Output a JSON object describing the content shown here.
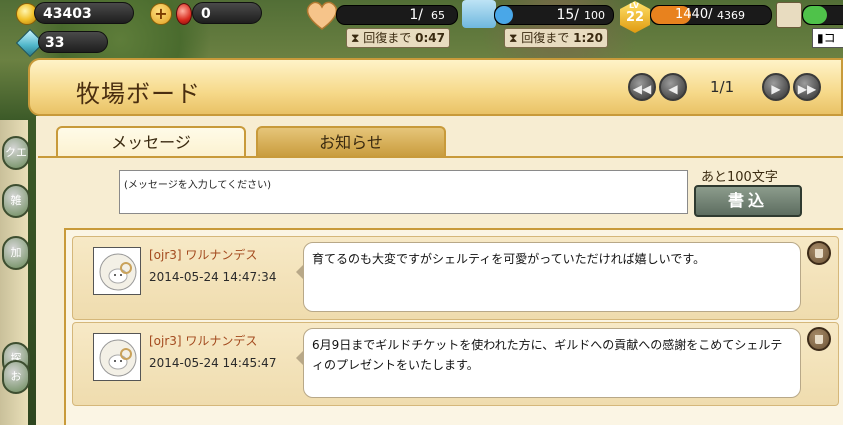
{
  "hud": {
    "coins": "43403",
    "gems": "33",
    "rubies": "0",
    "energy": {
      "value": "1/",
      "max": "65",
      "timer_label": "回復まで",
      "timer": "0:47"
    },
    "stamina": {
      "value": "15/",
      "max": "100",
      "fill_fraction": 0.15,
      "timer_label": "回復まで",
      "timer": "1:20"
    },
    "level": {
      "prefix": "LV",
      "value": "22"
    },
    "exp": {
      "text": "1440/",
      "max": "4369",
      "fill_fraction": 0.33
    },
    "right_label": "コ"
  },
  "side_menu": [
    "クエ",
    "雑",
    "加",
    "探",
    "お"
  ],
  "board": {
    "title": "牧場ボード",
    "page": "1/1",
    "tabs": [
      {
        "label": "メッセージ",
        "active": true
      },
      {
        "label": "お知らせ",
        "active": false
      }
    ],
    "input_placeholder": "(メッセージを入力してください)",
    "remaining": "あと100文字",
    "write_label": "書込",
    "messages": [
      {
        "name": "[ojr3] ワルナンデス",
        "time": "2014-05-24 14:47:34",
        "text": "育てるのも大変ですがシェルティを可愛がっていただければ嬉しいです。"
      },
      {
        "name": "[ojr3] ワルナンデス",
        "time": "2014-05-24 14:45:47",
        "text": "6月9日までギルドチケットを使われた方に、ギルドへの貢献への感謝をこめてシェルティのプレゼントをいたします。"
      }
    ]
  },
  "colors": {
    "accent": "#c89a3a",
    "stamina": "#49a7e8",
    "exp": "#e8821e",
    "name": "#a34a1e"
  }
}
